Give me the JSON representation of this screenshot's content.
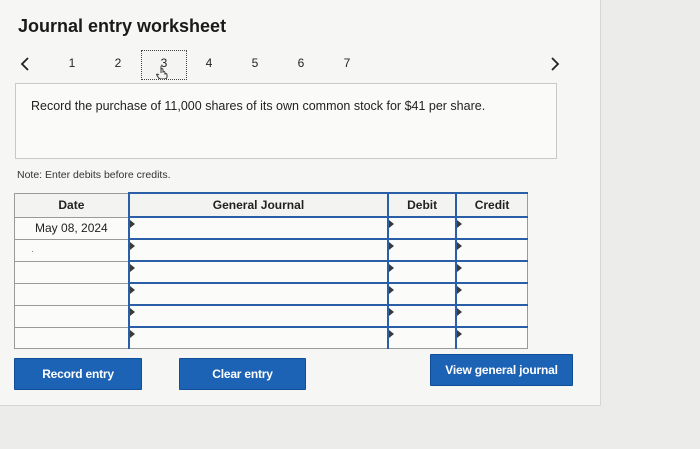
{
  "title": "Journal entry worksheet",
  "nav": {
    "steps": [
      "1",
      "2",
      "3",
      "4",
      "5",
      "6",
      "7"
    ],
    "active_step": "3",
    "prev_icon": "chevron-left-icon",
    "next_icon": "chevron-right-icon"
  },
  "prompt": "Record the purchase of 11,000 shares of its own common stock for $41 per share.",
  "note": "Note: Enter debits before credits.",
  "table": {
    "headers": {
      "date": "Date",
      "general_journal": "General Journal",
      "debit": "Debit",
      "credit": "Credit"
    },
    "rows": [
      {
        "date": "May 08, 2024",
        "account": "",
        "debit": "",
        "credit": ""
      },
      {
        "date": "",
        "account": "",
        "debit": "",
        "credit": ""
      },
      {
        "date": "",
        "account": "",
        "debit": "",
        "credit": ""
      },
      {
        "date": "",
        "account": "",
        "debit": "",
        "credit": ""
      },
      {
        "date": "",
        "account": "",
        "debit": "",
        "credit": ""
      },
      {
        "date": "",
        "account": "",
        "debit": "",
        "credit": ""
      }
    ]
  },
  "buttons": {
    "record_entry": "Record entry",
    "clear_entry": "Clear entry",
    "view_general_journal": "View general journal"
  },
  "colors": {
    "primary_button": "#1d63b5",
    "input_border": "#2a5fa8"
  }
}
